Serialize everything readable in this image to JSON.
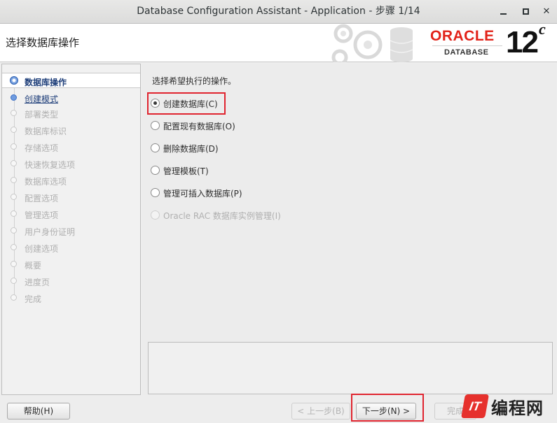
{
  "window": {
    "title": "Database Configuration Assistant - Application - 步骤 1/14"
  },
  "header": {
    "page_title": "选择数据库操作",
    "brand": "ORACLE",
    "brand_sub": "DATABASE",
    "version_number": "12",
    "version_suffix": "c"
  },
  "nav": {
    "items": [
      {
        "label": "数据库操作",
        "state": "current"
      },
      {
        "label": "创建模式",
        "state": "next"
      },
      {
        "label": "部署类型",
        "state": "disabled"
      },
      {
        "label": "数据库标识",
        "state": "disabled"
      },
      {
        "label": "存储选项",
        "state": "disabled"
      },
      {
        "label": "快速恢复选项",
        "state": "disabled"
      },
      {
        "label": "数据库选项",
        "state": "disabled"
      },
      {
        "label": "配置选项",
        "state": "disabled"
      },
      {
        "label": "管理选项",
        "state": "disabled"
      },
      {
        "label": "用户身份证明",
        "state": "disabled"
      },
      {
        "label": "创建选项",
        "state": "disabled"
      },
      {
        "label": "概要",
        "state": "disabled"
      },
      {
        "label": "进度页",
        "state": "disabled"
      },
      {
        "label": "完成",
        "state": "disabled"
      }
    ]
  },
  "main": {
    "instruction": "选择希望执行的操作。",
    "options": [
      {
        "label": "创建数据库(C)",
        "selected": true,
        "enabled": true
      },
      {
        "label": "配置现有数据库(O)",
        "selected": false,
        "enabled": true
      },
      {
        "label": "删除数据库(D)",
        "selected": false,
        "enabled": true
      },
      {
        "label": "管理模板(T)",
        "selected": false,
        "enabled": true
      },
      {
        "label": "管理可插入数据库(P)",
        "selected": false,
        "enabled": true
      },
      {
        "label": "Oracle RAC 数据库实例管理(I)",
        "selected": false,
        "enabled": false
      }
    ]
  },
  "footer": {
    "help_label": "帮助(H)",
    "back_label": "< 上一步(B)",
    "next_label": "下一步(N) >",
    "finish_label": "完成"
  },
  "watermark": {
    "text": "编程网"
  },
  "colors": {
    "highlight": "#e0242f",
    "oracle_red": "#e2231a",
    "nav_current": "#1f3f7a"
  }
}
